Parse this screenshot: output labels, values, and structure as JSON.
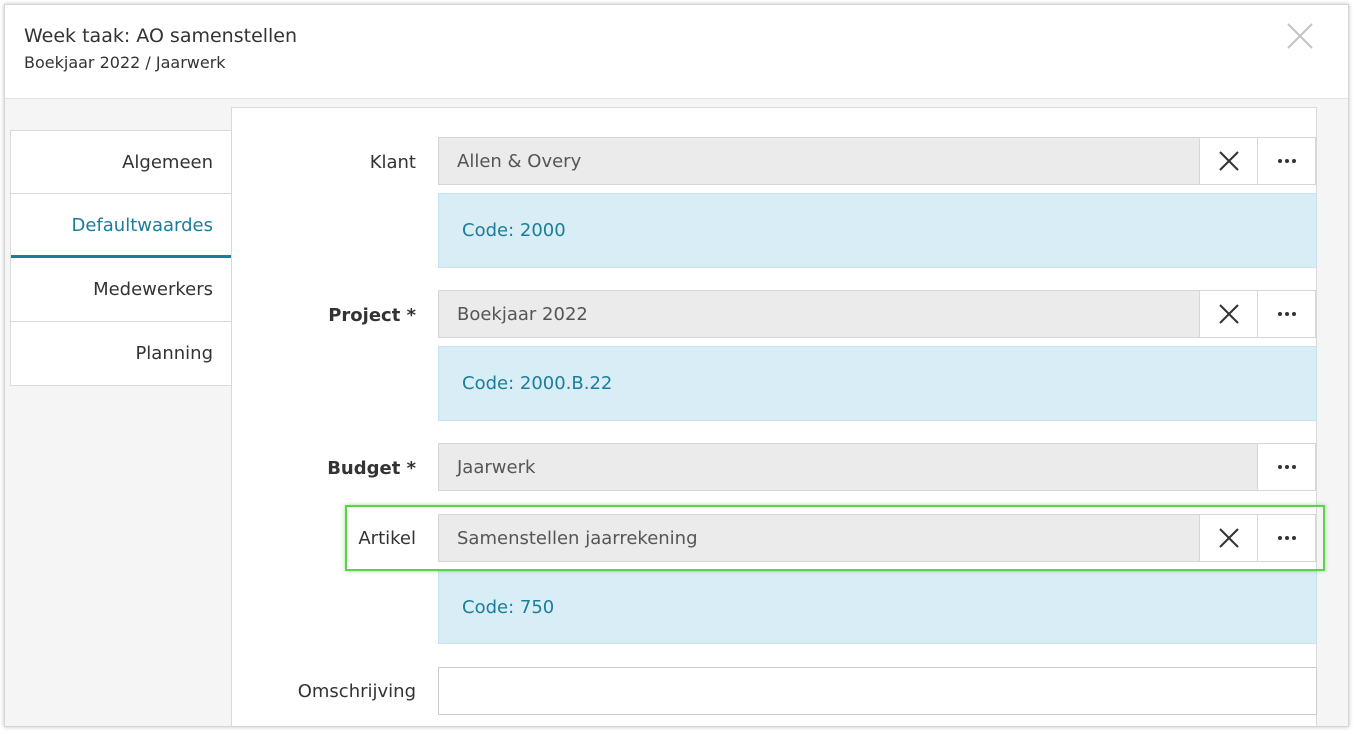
{
  "dialog": {
    "title": "Week taak: AO samenstellen",
    "subtitle": "Boekjaar 2022 / Jaarwerk"
  },
  "tabs": [
    {
      "label": "Algemeen",
      "active": false
    },
    {
      "label": "Defaultwaardes",
      "active": true
    },
    {
      "label": "Medewerkers",
      "active": false
    },
    {
      "label": "Planning",
      "active": false
    }
  ],
  "fields": {
    "klant": {
      "label": "Klant",
      "value": "Allen & Overy",
      "code": "Code: 2000"
    },
    "project": {
      "label": "Project *",
      "value": "Boekjaar 2022",
      "code": "Code: 2000.B.22"
    },
    "budget": {
      "label": "Budget *",
      "value": "Jaarwerk"
    },
    "artikel": {
      "label": "Artikel",
      "value": "Samenstellen jaarrekening",
      "code": "Code: 750"
    },
    "omschrijving": {
      "label": "Omschrijving",
      "value": ""
    }
  },
  "colors": {
    "accent": "#1a7d9c",
    "info_background": "#d9edf7",
    "highlight": "#5dd34a"
  },
  "icons": {
    "close": "close-icon",
    "clear": "x-icon",
    "more": "ellipsis-icon"
  }
}
